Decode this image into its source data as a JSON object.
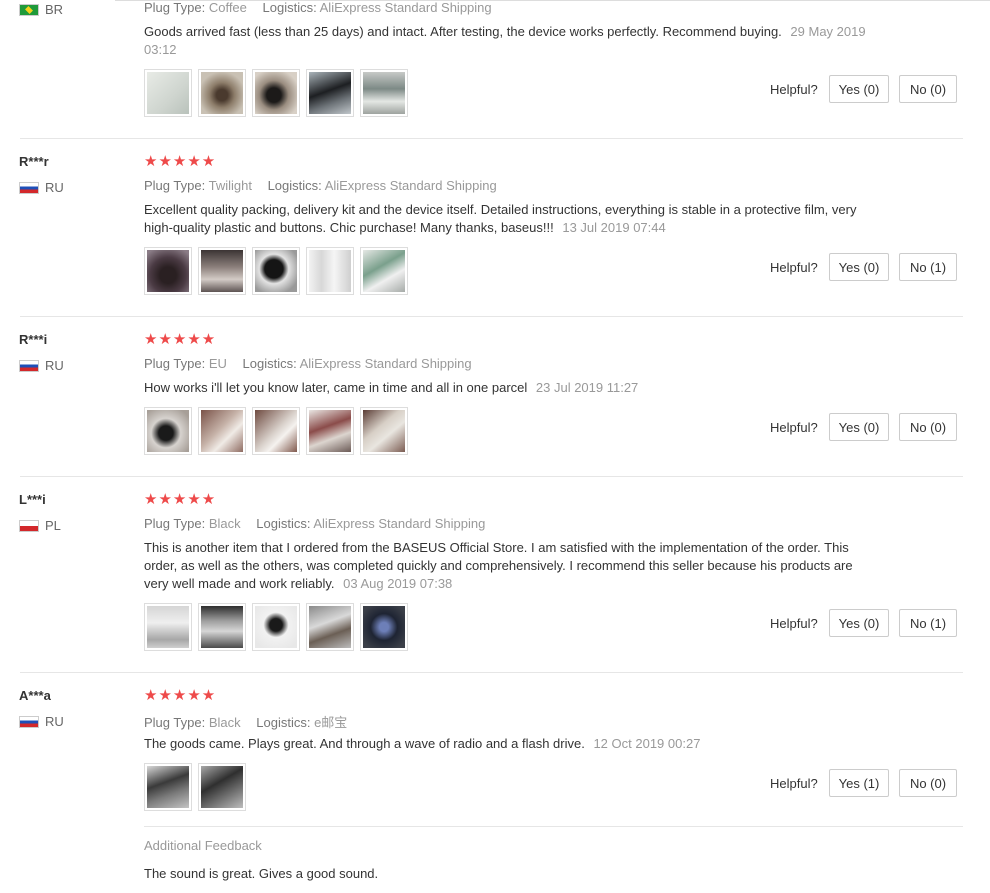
{
  "labels": {
    "plug_type": "Plug Type:",
    "logistics": "Logistics:",
    "helpful": "Helpful?",
    "stars": "★★★★★",
    "additional_feedback": "Additional Feedback"
  },
  "reviews": [
    {
      "user": "",
      "country": "BR",
      "plug_type": "Coffee",
      "logistics": "AliExpress Standard Shipping",
      "text": "Goods arrived fast (less than 25 days) and intact. After testing, the device works perfectly. Recommend buying.",
      "date": "29 May 2019 03:12",
      "yes": "Yes (0)",
      "no": "No (0)",
      "photo_count": 5
    },
    {
      "user": "R***r",
      "country": "RU",
      "plug_type": "Twilight",
      "logistics": "AliExpress Standard Shipping",
      "text": "Excellent quality packing, delivery kit and the device itself. Detailed instructions, everything is stable in a protective film, very high-quality plastic and buttons. Chic purchase! Many thanks, baseus!!!",
      "date": "13 Jul 2019 07:44",
      "yes": "Yes (0)",
      "no": "No (1)",
      "photo_count": 5
    },
    {
      "user": "R***i",
      "country": "RU",
      "plug_type": "EU",
      "logistics": "AliExpress Standard Shipping",
      "text": "How works i'll let you know later, came in time and all in one parcel",
      "date": "23 Jul 2019 11:27",
      "yes": "Yes (0)",
      "no": "No (0)",
      "photo_count": 5
    },
    {
      "user": "L***i",
      "country": "PL",
      "plug_type": "Black",
      "logistics": "AliExpress Standard Shipping",
      "text": "This is another item that I ordered from the BASEUS Official Store. I am satisfied with the implementation of the order. This order, as well as the others, was completed quickly and comprehensively. I recommend this seller because his products are very well made and work reliably.",
      "date": "03 Aug 2019 07:38",
      "yes": "Yes (0)",
      "no": "No (1)",
      "photo_count": 5
    },
    {
      "user": "A***a",
      "country": "RU",
      "plug_type": "Black",
      "logistics": "e邮宝",
      "text": "The goods came. Plays great. And through a wave of radio and a flash drive.",
      "date": "12 Oct 2019 00:27",
      "yes": "Yes (1)",
      "no": "No (0)",
      "photo_count": 2,
      "additional_feedback": "The sound is great. Gives a good sound."
    }
  ],
  "colors": {
    "star": "#ee4a4a",
    "muted": "#999999",
    "border": "#cccccc"
  }
}
